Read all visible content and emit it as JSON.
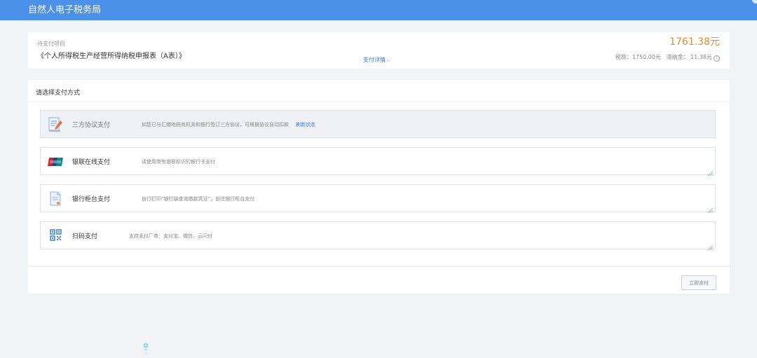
{
  "header": {
    "title": "自然人电子税务局"
  },
  "summary": {
    "pending_label": "待支付项目",
    "form_name": "《个人所得税生产经营所得纳税申报表（A表）》",
    "detail_link": "支付详情",
    "total_amount": "1761.38元",
    "tax_label": "税款：",
    "tax_value": "1750.00元",
    "late_fee_label": "滞纳金：",
    "late_fee_value": "11.38元"
  },
  "payment": {
    "heading": "请选择支付方式",
    "options": [
      {
        "name": "三方协议支付",
        "icon": "pen-document-icon",
        "description": "如您已与汇缴地税务机关和银行签订三方协议，可根据协议自动扣款",
        "refresh_label": "刷新状态",
        "selected": true
      },
      {
        "name": "银联在线支付",
        "icon": "unionpay-icon",
        "description": "请使用带有银联标识的银行卡支付",
        "selected": false
      },
      {
        "name": "银行柜台支付",
        "icon": "bank-document-icon",
        "description": "自行打印“银行端查询缴款凭证”，前往银行柜台支付",
        "selected": false
      },
      {
        "name": "扫码支付",
        "icon": "qr-code-icon",
        "description": "支持支付厂商：支付宝、微信、云闪付",
        "selected": false
      }
    ],
    "pay_button": "立即支付"
  },
  "colors": {
    "topbar": "#4b91e9",
    "amount": "#e8892b",
    "link": "#3b7fd9"
  }
}
